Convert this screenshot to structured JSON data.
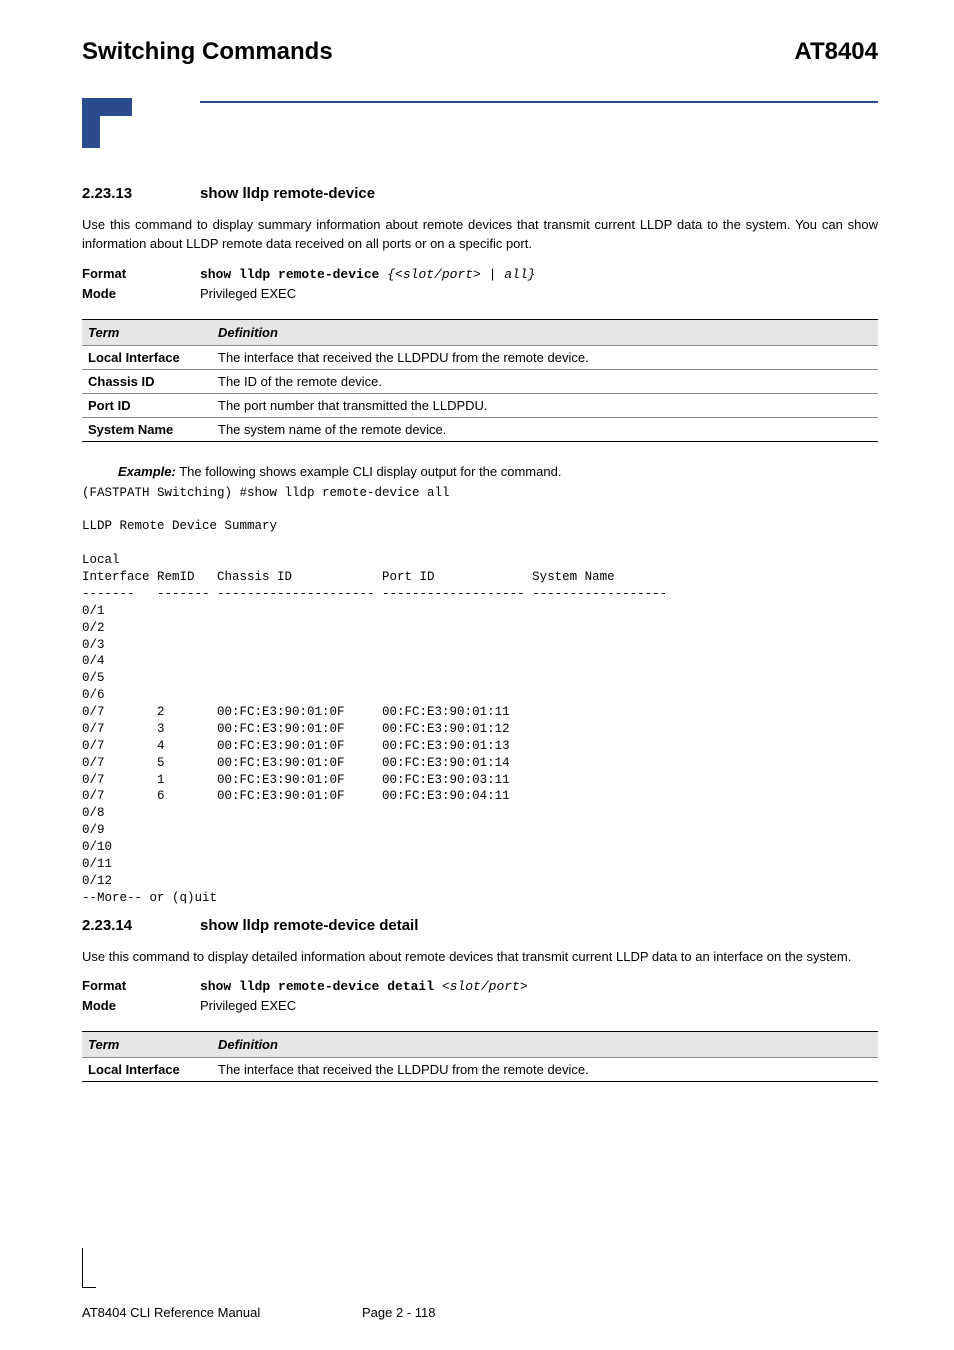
{
  "header": {
    "left": "Switching Commands",
    "right": "AT8404"
  },
  "section1": {
    "num": "2.23.13",
    "title": "show lldp remote-device",
    "desc": "Use this command to display summary information about remote devices that transmit current LLDP data to the system. You can show information about LLDP remote data received on all ports or on a specific port.",
    "format_label": "Format",
    "format_cmd": "show lldp remote-device ",
    "format_arg": "{<slot/port> | all}",
    "mode_label": "Mode",
    "mode_value": "Privileged EXEC",
    "table": {
      "th_term": "Term",
      "th_def": "Definition",
      "rows": [
        {
          "term": "Local Interface",
          "def": "The interface that received the LLDPDU from the remote device."
        },
        {
          "term": "Chassis ID",
          "def": "The ID of the remote device."
        },
        {
          "term": "Port ID",
          "def": "The port number that transmitted the LLDPDU."
        },
        {
          "term": "System Name",
          "def": "The system name of the remote device."
        }
      ]
    },
    "example_label": "Example:",
    "example_text": " The following shows example CLI display output for the command.",
    "cli": "(FASTPATH Switching) #show lldp remote-device all\n\nLLDP Remote Device Summary\n\nLocal\nInterface RemID   Chassis ID            Port ID             System Name\n-------   ------- --------------------- ------------------- ------------------\n0/1\n0/2\n0/3\n0/4\n0/5\n0/6\n0/7       2       00:FC:E3:90:01:0F     00:FC:E3:90:01:11\n0/7       3       00:FC:E3:90:01:0F     00:FC:E3:90:01:12\n0/7       4       00:FC:E3:90:01:0F     00:FC:E3:90:01:13\n0/7       5       00:FC:E3:90:01:0F     00:FC:E3:90:01:14\n0/7       1       00:FC:E3:90:01:0F     00:FC:E3:90:03:11\n0/7       6       00:FC:E3:90:01:0F     00:FC:E3:90:04:11\n0/8\n0/9\n0/10\n0/11\n0/12\n--More-- or (q)uit"
  },
  "section2": {
    "num": "2.23.14",
    "title": "show lldp remote-device detail",
    "desc": "Use this command to display detailed information about remote devices that transmit current LLDP data to an interface on the system.",
    "format_label": "Format",
    "format_cmd": "show lldp remote-device detail ",
    "format_arg": "<slot/port>",
    "mode_label": "Mode",
    "mode_value": "Privileged EXEC",
    "table": {
      "th_term": "Term",
      "th_def": "Definition",
      "rows": [
        {
          "term": "Local Interface",
          "def": "The interface that received the LLDPDU from the remote device."
        }
      ]
    }
  },
  "footer": {
    "left": "AT8404 CLI Reference Manual",
    "page": "Page 2 - 118"
  }
}
